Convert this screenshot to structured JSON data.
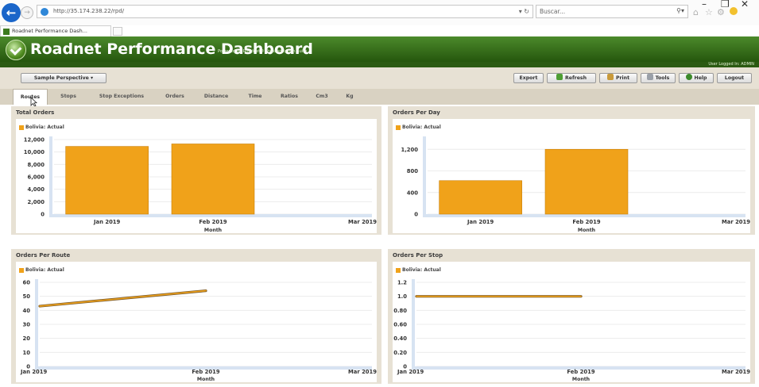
{
  "browser": {
    "url": "http://35.174.238.22/rpd/",
    "search_placeholder": "Buscar...",
    "tab_title": "Roadnet Performance Dash...",
    "window_controls": [
      "–",
      "❐",
      "✕"
    ]
  },
  "app": {
    "title": "Roadnet Performance Dashboard",
    "subtitle": "Powered by Roadnet® Transportation Suite",
    "user_logged": "User Logged In:  ADMIN"
  },
  "toolbar": {
    "perspective": "Sample Perspective",
    "export": "Export",
    "refresh": "Refresh",
    "print": "Print",
    "tools": "Tools",
    "help": "Help",
    "logout": "Logout"
  },
  "tabs": [
    "Routes",
    "Stops",
    "Stop Exceptions",
    "Orders",
    "Distance",
    "Time",
    "Ratios",
    "Cm3",
    "Kg"
  ],
  "colors": {
    "accent": "#f0a21a",
    "header": "#2f6a15",
    "panel_bg": "#e7e1d4",
    "line_dark": "#7a5a2a"
  },
  "panels": [
    {
      "title": "Total Orders",
      "legend": "Bolivia: Actual",
      "xlabel": "Month"
    },
    {
      "title": "Orders Per Day",
      "legend": "Bolivia: Actual",
      "xlabel": "Month"
    },
    {
      "title": "Orders Per Route",
      "legend": "Bolivia: Actual",
      "xlabel": "Month"
    },
    {
      "title": "Orders Per Stop",
      "legend": "Bolivia: Actual",
      "xlabel": "Month"
    }
  ],
  "chart_data": [
    {
      "type": "bar",
      "title": "Total Orders",
      "xlabel": "Month",
      "ylabel": "",
      "categories": [
        "Jan 2019",
        "Feb 2019",
        "Mar 2019"
      ],
      "series": [
        {
          "name": "Bolivia: Actual",
          "values": [
            10900,
            11300,
            null
          ]
        }
      ],
      "y_ticks": [
        "12,000",
        "10,000",
        "8,000",
        "6,000",
        "4,000",
        "2,000",
        "0"
      ],
      "ylim": [
        0,
        12000
      ],
      "legend": "top-left"
    },
    {
      "type": "bar",
      "title": "Orders Per Day",
      "xlabel": "Month",
      "ylabel": "",
      "categories": [
        "Jan 2019",
        "Feb 2019",
        "Mar 2019"
      ],
      "series": [
        {
          "name": "Bolivia: Actual",
          "values": [
            620,
            1200,
            null
          ]
        }
      ],
      "y_ticks": [
        "1,200",
        "800",
        "400",
        "0"
      ],
      "ylim": [
        0,
        1380
      ],
      "legend": "top-left"
    },
    {
      "type": "line",
      "title": "Orders Per Route",
      "xlabel": "Month",
      "ylabel": "",
      "categories": [
        "Jan 2019",
        "Feb 2019",
        "Mar 2019"
      ],
      "series": [
        {
          "name": "Bolivia: Actual",
          "values": [
            43,
            54,
            null
          ]
        }
      ],
      "y_ticks": [
        "60",
        "50",
        "40",
        "30",
        "20",
        "10",
        "0"
      ],
      "ylim": [
        0,
        60
      ],
      "legend": "top-left"
    },
    {
      "type": "line",
      "title": "Orders Per Stop",
      "xlabel": "Month",
      "ylabel": "",
      "categories": [
        "Jan 2019",
        "Feb 2019",
        "Mar 2019"
      ],
      "series": [
        {
          "name": "Bolivia: Actual",
          "values": [
            1.0,
            1.0,
            null
          ]
        }
      ],
      "y_ticks": [
        "1.2",
        "1.0",
        "0.80",
        "0.60",
        "0.40",
        "0.20",
        "0"
      ],
      "ylim": [
        0,
        1.2
      ],
      "legend": "top-left"
    }
  ]
}
